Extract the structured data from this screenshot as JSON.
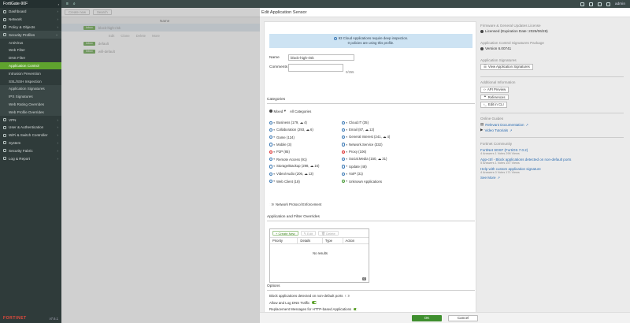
{
  "sidebar": {
    "device": "FortiGate-90F",
    "items": [
      {
        "label": "Dashboard",
        "icon": "dashboard-icon"
      },
      {
        "label": "Network",
        "icon": "network-icon"
      },
      {
        "label": "Policy & Objects",
        "icon": "policy-icon"
      }
    ],
    "security_profiles": "Security Profiles",
    "sub_items": [
      {
        "label": "AntiVirus"
      },
      {
        "label": "Web Filter"
      },
      {
        "label": "DNS Filter"
      },
      {
        "label": "Application Control",
        "active": true
      },
      {
        "label": "Intrusion Prevention"
      },
      {
        "label": "SSL/SSH Inspection"
      },
      {
        "label": "Application Signatures",
        "light": true
      },
      {
        "label": "IPS Signatures",
        "light": true
      },
      {
        "label": "Web Rating Overrides",
        "light": true
      },
      {
        "label": "Web Profile Overrides",
        "light": true
      }
    ],
    "lower_items": [
      {
        "label": "VPN"
      },
      {
        "label": "User & Authentication"
      },
      {
        "label": "WiFi & Switch Controller"
      },
      {
        "label": "System"
      },
      {
        "label": "Security Fabric"
      },
      {
        "label": "Log & Report"
      }
    ],
    "logo": "FORTINET",
    "version": "v7.6.1"
  },
  "topbar": {
    "user": "admin"
  },
  "background": {
    "create_new": "Create new",
    "search_placeholder": "Search",
    "name_header": "Name",
    "rows": [
      {
        "tag": "Inbox",
        "name": "block-high-risk",
        "selected": true
      },
      {
        "tag": "Inbox",
        "name": "default",
        "selected": false
      },
      {
        "tag": "Inbox",
        "name": "wifi-default",
        "selected": false
      }
    ],
    "ctx": [
      "Edit",
      "Clone",
      "Delete",
      "More"
    ]
  },
  "panel": {
    "title": "Edit Application Sensor",
    "info_line1": "93 Cloud Applications require deep inspection.",
    "info_line2": "0 policies are using this profile.",
    "name_label": "Name",
    "name_value": "block-high-risk",
    "comments_label": "Comments",
    "comments_placeholder": "",
    "comments_counter": "0/255",
    "categories_label": "Categories",
    "mixed_label": "Mixed",
    "all_categories": "All Categories",
    "categories_left": [
      {
        "label": "Business (179, ☁ 4)",
        "action": "monitor"
      },
      {
        "label": "Collaboration (293, ☁ 6)",
        "action": "monitor"
      },
      {
        "label": "Game (124)",
        "action": "monitor"
      },
      {
        "label": "Mobile (3)",
        "action": "monitor"
      },
      {
        "label": "P2P (85)",
        "action": "block"
      },
      {
        "label": "Remote Access (91)",
        "action": "monitor"
      },
      {
        "label": "Storage/Backup (298, ☁ 16)",
        "action": "monitor"
      },
      {
        "label": "Video/Audio (206, ☁ 13)",
        "action": "monitor"
      },
      {
        "label": "Web Client (18)",
        "action": "monitor"
      }
    ],
    "categories_right": [
      {
        "label": "Cloud.IT (35)",
        "action": "monitor"
      },
      {
        "label": "Email (87, ☁ 12)",
        "action": "monitor"
      },
      {
        "label": "General Interest (241, ☁ 4)",
        "action": "monitor"
      },
      {
        "label": "Network.Service (332)",
        "action": "monitor"
      },
      {
        "label": "Proxy (106)",
        "action": "block"
      },
      {
        "label": "Social.Media (150, ☁ 31)",
        "action": "monitor"
      },
      {
        "label": "Update (48)",
        "action": "monitor"
      },
      {
        "label": "VoIP (31)",
        "action": "monitor"
      },
      {
        "label": "Unknown Applications",
        "action": "allow"
      }
    ],
    "network_protocol": "Network Protocol Enforcement",
    "overrides_label": "Application and Filter Overrides",
    "create_new": "+ Create New",
    "edit": "Edit",
    "delete": "Delete",
    "col_priority": "Priority",
    "col_details": "Details",
    "col_type": "Type",
    "col_action": "Action",
    "no_results": "No results",
    "results_count": "0",
    "options_label": "Options",
    "options": [
      {
        "label": "Block applications detected on non-default ports",
        "on": false
      },
      {
        "label": "Allow and Log DNS Traffic",
        "on": true
      },
      {
        "label": "Replacement Messages for HTTP-based Applications",
        "on": true
      }
    ]
  },
  "rightcol": {
    "license_head": "Firmware & General Updates License",
    "license_value": "Licensed (Expiration Date: 2026/06/28)",
    "package_head": "Application Control Signatures Package",
    "package_value": "Version 6.00741",
    "signatures_head": "Application Signatures",
    "view_signatures": "View Application Signatures",
    "additional_head": "Additional Information",
    "api_preview": "API Preview",
    "references": "References",
    "edit_cli": "Edit in CLI",
    "guides_head": "Online Guides",
    "relevant_docs": "Relevant Documentation",
    "video_tutorials": "Video Tutorials",
    "community_head": "Fortinet Community",
    "posts": [
      {
        "title": "FortiNet SDSF (FortiOS 7.0.2)",
        "meta": "4 Answers   1 Votes   296 Views"
      },
      {
        "title": "App-ctrl - Block applications detected on non-default ports",
        "meta": "5 Answers   1 Votes   157 Views"
      },
      {
        "title": "Help with custom application signature",
        "meta": "4 Answers   0 Votes   171 Views"
      }
    ],
    "see_more": "See More"
  },
  "footer": {
    "ok": "OK",
    "cancel": "Cancel"
  }
}
